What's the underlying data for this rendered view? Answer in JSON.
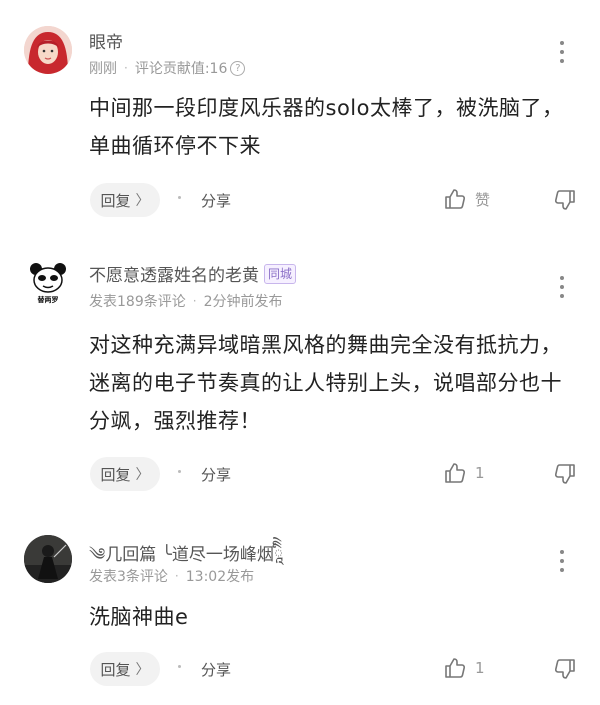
{
  "comments": [
    {
      "author": "眼帝",
      "badge": "",
      "meta": {
        "time": "刚刚",
        "contrib": "评论贡献值:16",
        "help": "?"
      },
      "lines": [
        "中间那一段印度风乐器的solo太棒了，被洗脑了，",
        "单曲循环停不下来"
      ],
      "reply_label": "回复",
      "reply_chevron": "〉",
      "share_label": "分享",
      "like_label": "赞"
    },
    {
      "author": "不愿意透露姓名的老黄",
      "badge": "同城",
      "meta": {
        "posts": "发表189条评论",
        "time": "2分钟前发布"
      },
      "lines": [
        "对这种充满异域暗黑风格的舞曲完全没有抵抗力，",
        "迷离的电子节奏真的让人特别上头，说唱部分也十",
        "分飒，强烈推荐！"
      ],
      "reply_label": "回复",
      "reply_chevron": "〉",
      "share_label": "分享",
      "like_label": "1",
      "avatar_caption": "替两罗"
    },
    {
      "author": "༄几回篇 ╰道尽一场峰烟ཱིིེ",
      "badge": "",
      "meta": {
        "posts": "发表3条评论",
        "time": "13:02发布"
      },
      "lines": [
        "洗脑神曲e"
      ],
      "reply_label": "回复",
      "reply_chevron": "〉",
      "share_label": "分享",
      "like_label": "1"
    }
  ]
}
